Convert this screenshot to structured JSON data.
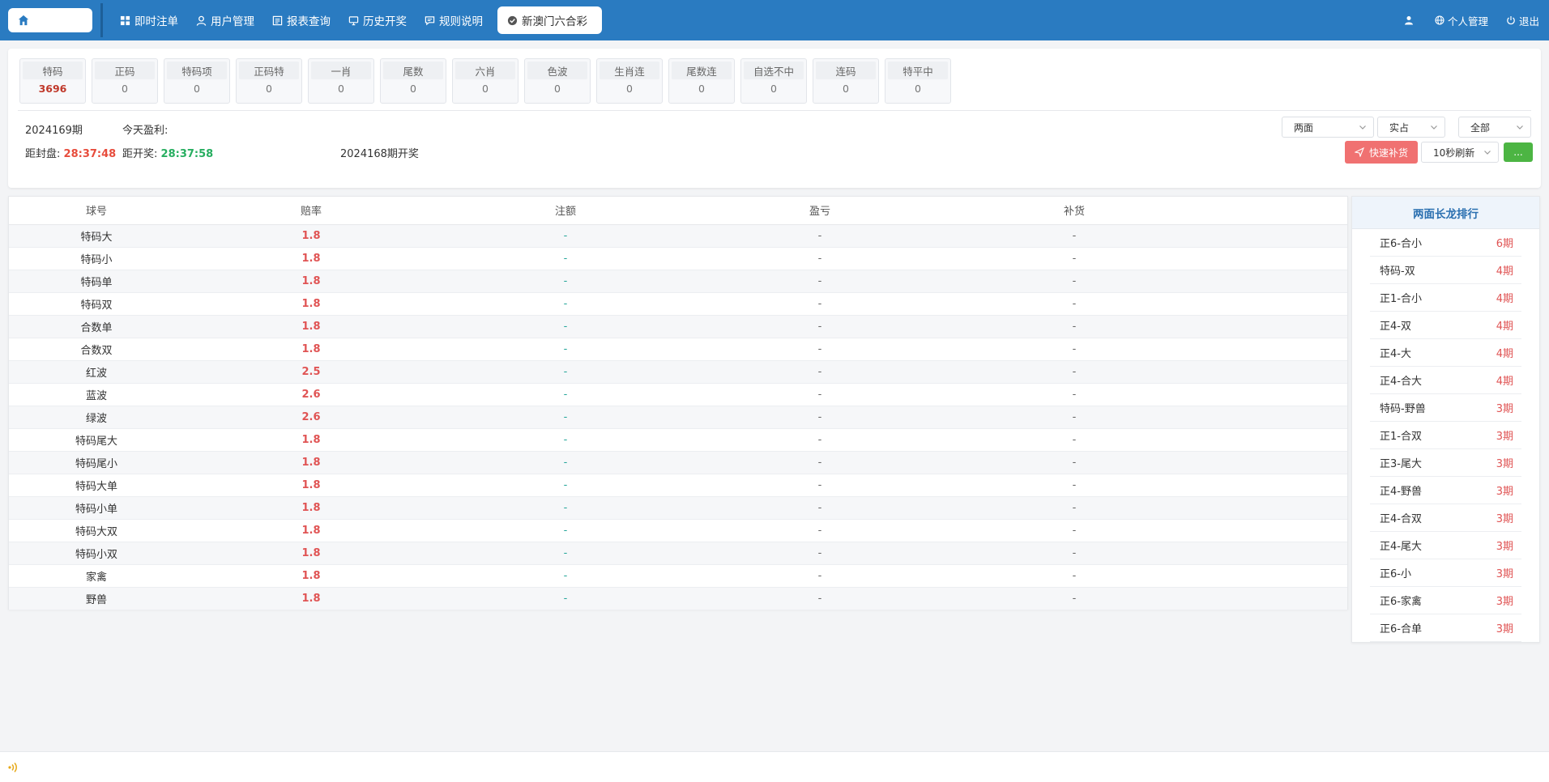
{
  "nav": {
    "items": [
      {
        "label": "即时注单",
        "icon": "grid-icon"
      },
      {
        "label": "用户管理",
        "icon": "user-icon"
      },
      {
        "label": "报表查询",
        "icon": "report-icon"
      },
      {
        "label": "历史开奖",
        "icon": "monitor-icon"
      },
      {
        "label": "规则说明",
        "icon": "chat-icon"
      }
    ],
    "active_tab": "新澳门六合彩"
  },
  "top_right": {
    "personal": "个人管理",
    "logout": "退出"
  },
  "categories": [
    {
      "name": "特码",
      "value": "3696"
    },
    {
      "name": "正码",
      "value": "0"
    },
    {
      "name": "特码项",
      "value": "0"
    },
    {
      "name": "正码特",
      "value": "0"
    },
    {
      "name": "一肖",
      "value": "0"
    },
    {
      "name": "尾数",
      "value": "0"
    },
    {
      "name": "六肖",
      "value": "0"
    },
    {
      "name": "色波",
      "value": "0"
    },
    {
      "name": "生肖连",
      "value": "0"
    },
    {
      "name": "尾数连",
      "value": "0"
    },
    {
      "name": "自选不中",
      "value": "0"
    },
    {
      "name": "连码",
      "value": "0"
    },
    {
      "name": "特平中",
      "value": "0"
    }
  ],
  "info": {
    "period": "2024169期",
    "profit_label": "今天盈利:",
    "close_label": "距封盘:",
    "close_time": "28:37:48",
    "open_label": "距开奖:",
    "open_time": "28:37:58",
    "last_draw": "2024168期开奖"
  },
  "controls": {
    "sel1": "两面",
    "sel2": "实占",
    "sel3": "全部",
    "refresh": "10秒刷新",
    "quick_btn": "快速补货",
    "more_btn": "..."
  },
  "table": {
    "headers": [
      "球号",
      "赔率",
      "注额",
      "盈亏",
      "补货"
    ],
    "rows": [
      {
        "name": "特码大",
        "rate": "1.8",
        "bet": "-",
        "pl": "-",
        "fill": "-"
      },
      {
        "name": "特码小",
        "rate": "1.8",
        "bet": "-",
        "pl": "-",
        "fill": "-"
      },
      {
        "name": "特码单",
        "rate": "1.8",
        "bet": "-",
        "pl": "-",
        "fill": "-"
      },
      {
        "name": "特码双",
        "rate": "1.8",
        "bet": "-",
        "pl": "-",
        "fill": "-"
      },
      {
        "name": "合数单",
        "rate": "1.8",
        "bet": "-",
        "pl": "-",
        "fill": "-"
      },
      {
        "name": "合数双",
        "rate": "1.8",
        "bet": "-",
        "pl": "-",
        "fill": "-"
      },
      {
        "name": "红波",
        "rate": "2.5",
        "bet": "-",
        "pl": "-",
        "fill": "-"
      },
      {
        "name": "蓝波",
        "rate": "2.6",
        "bet": "-",
        "pl": "-",
        "fill": "-"
      },
      {
        "name": "绿波",
        "rate": "2.6",
        "bet": "-",
        "pl": "-",
        "fill": "-"
      },
      {
        "name": "特码尾大",
        "rate": "1.8",
        "bet": "-",
        "pl": "-",
        "fill": "-"
      },
      {
        "name": "特码尾小",
        "rate": "1.8",
        "bet": "-",
        "pl": "-",
        "fill": "-"
      },
      {
        "name": "特码大单",
        "rate": "1.8",
        "bet": "-",
        "pl": "-",
        "fill": "-"
      },
      {
        "name": "特码小单",
        "rate": "1.8",
        "bet": "-",
        "pl": "-",
        "fill": "-"
      },
      {
        "name": "特码大双",
        "rate": "1.8",
        "bet": "-",
        "pl": "-",
        "fill": "-"
      },
      {
        "name": "特码小双",
        "rate": "1.8",
        "bet": "-",
        "pl": "-",
        "fill": "-"
      },
      {
        "name": "家禽",
        "rate": "1.8",
        "bet": "-",
        "pl": "-",
        "fill": "-"
      },
      {
        "name": "野兽",
        "rate": "1.8",
        "bet": "-",
        "pl": "-",
        "fill": "-"
      }
    ]
  },
  "ranking": {
    "title": "两面长龙排行",
    "items": [
      {
        "name": "正6-合小",
        "value": "6期"
      },
      {
        "name": "特码-双",
        "value": "4期"
      },
      {
        "name": "正1-合小",
        "value": "4期"
      },
      {
        "name": "正4-双",
        "value": "4期"
      },
      {
        "name": "正4-大",
        "value": "4期"
      },
      {
        "name": "正4-合大",
        "value": "4期"
      },
      {
        "name": "特码-野兽",
        "value": "3期"
      },
      {
        "name": "正1-合双",
        "value": "3期"
      },
      {
        "name": "正3-尾大",
        "value": "3期"
      },
      {
        "name": "正4-野兽",
        "value": "3期"
      },
      {
        "name": "正4-合双",
        "value": "3期"
      },
      {
        "name": "正4-尾大",
        "value": "3期"
      },
      {
        "name": "正6-小",
        "value": "3期"
      },
      {
        "name": "正6-家禽",
        "value": "3期"
      },
      {
        "name": "正6-合单",
        "value": "3期"
      }
    ]
  }
}
